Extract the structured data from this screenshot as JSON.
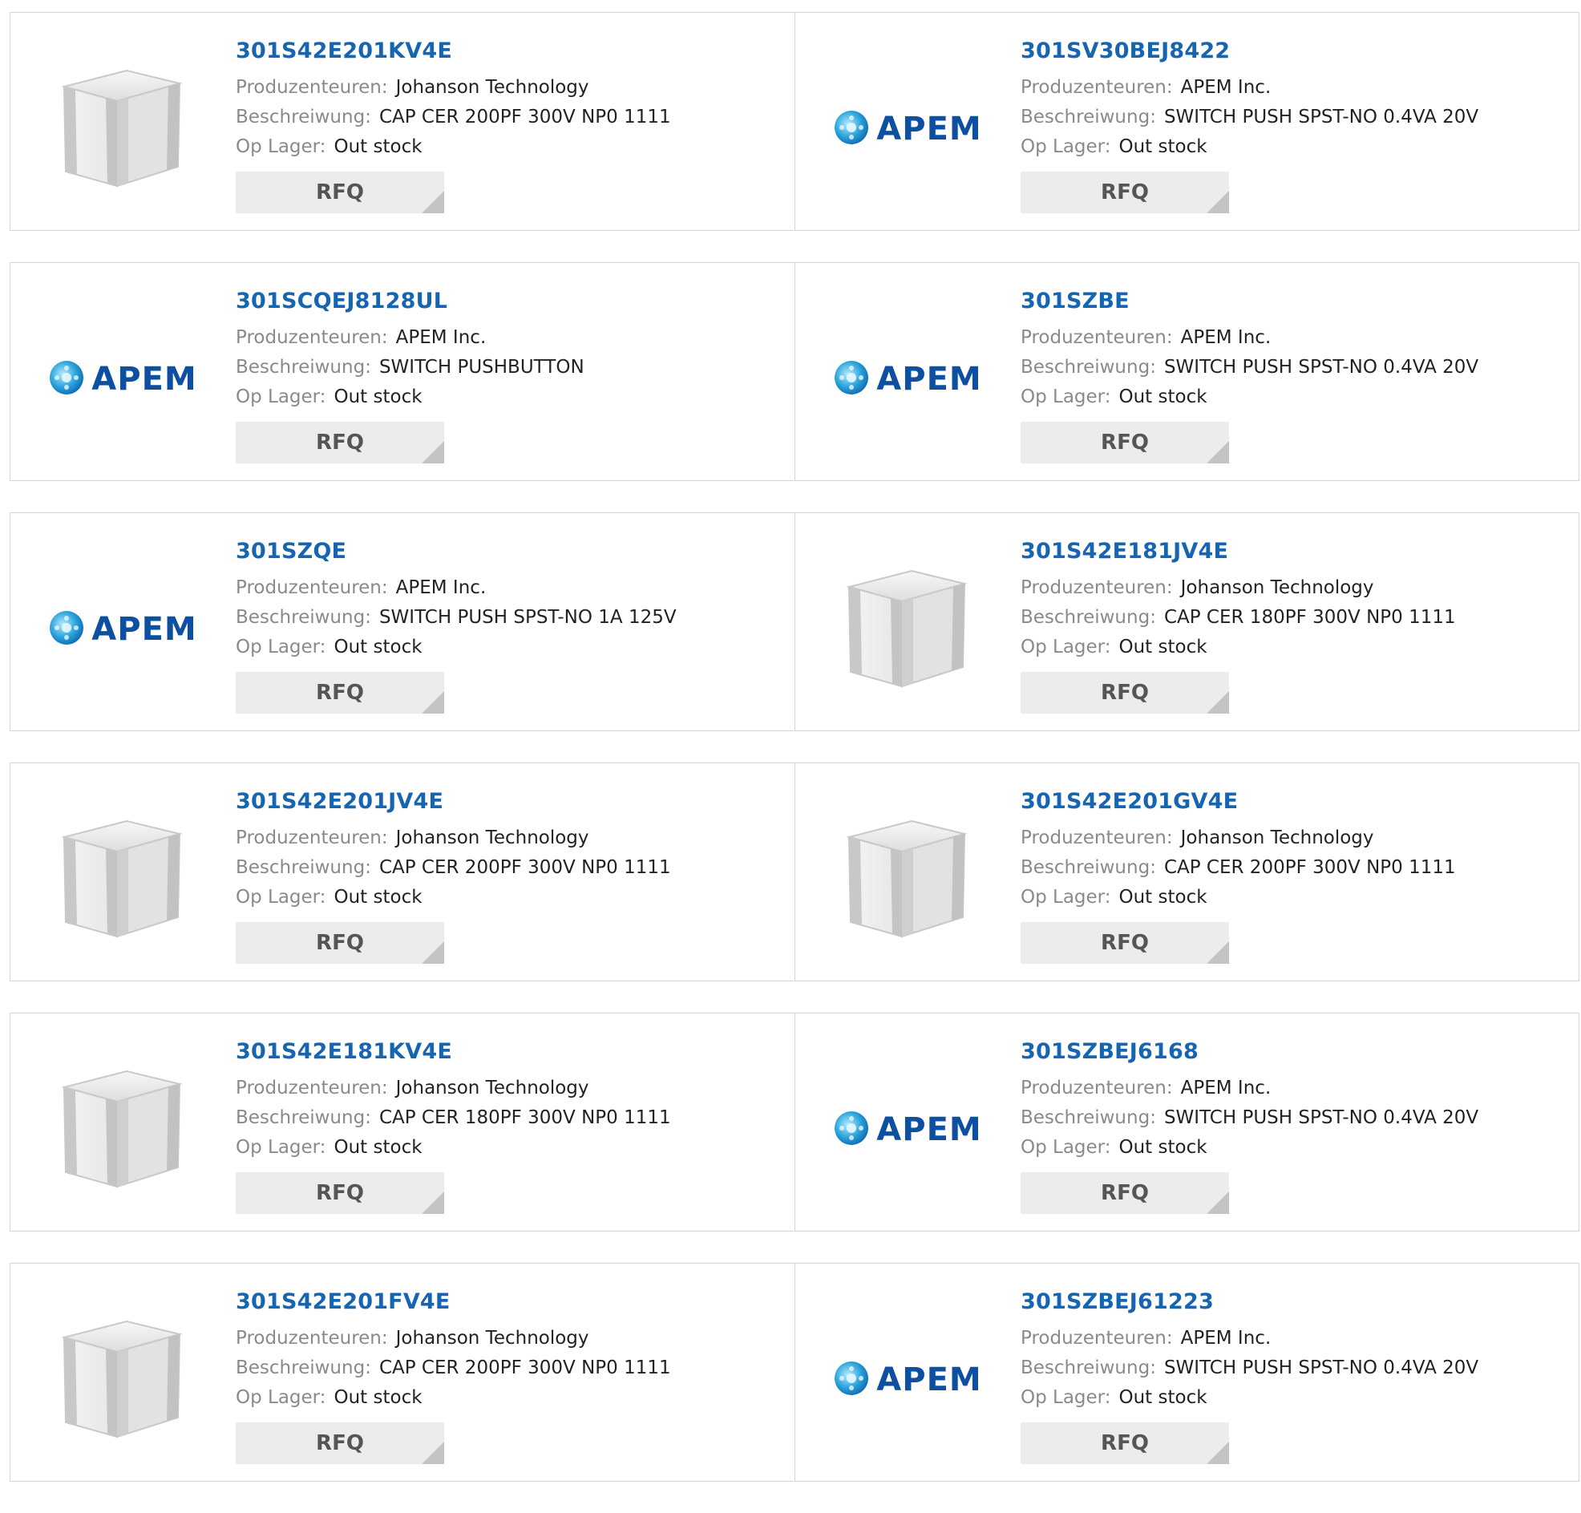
{
  "labels": {
    "manufacturer": "Produzenteuren:",
    "description": "Beschreiwung:",
    "stock": "Op Lager:",
    "rfq": "RFQ"
  },
  "colors": {
    "part_link": "#1565b2",
    "label_grey": "#8a8a8a",
    "rfq_bg": "#ececec",
    "apem_blue": "#0d4fa0"
  },
  "products": [
    {
      "part": "301S42E201KV4E",
      "manufacturer": "Johanson Technology",
      "description": "CAP CER 200PF 300V NP0 1111",
      "stock": "Out stock",
      "image": "capacitor-image"
    },
    {
      "part": "301SV30BEJ8422",
      "manufacturer": "APEM Inc.",
      "description": "SWITCH PUSH SPST-NO 0.4VA 20V",
      "stock": "Out stock",
      "image": "apem-logo",
      "logo_text": "APEM"
    },
    {
      "part": "301SCQEJ8128UL",
      "manufacturer": "APEM Inc.",
      "description": "SWITCH PUSHBUTTON",
      "stock": "Out stock",
      "image": "apem-logo",
      "logo_text": "APEM"
    },
    {
      "part": "301SZBE",
      "manufacturer": "APEM Inc.",
      "description": "SWITCH PUSH SPST-NO 0.4VA 20V",
      "stock": "Out stock",
      "image": "apem-logo",
      "logo_text": "APEM"
    },
    {
      "part": "301SZQE",
      "manufacturer": "APEM Inc.",
      "description": "SWITCH PUSH SPST-NO 1A 125V",
      "stock": "Out stock",
      "image": "apem-logo",
      "logo_text": "APEM"
    },
    {
      "part": "301S42E181JV4E",
      "manufacturer": "Johanson Technology",
      "description": "CAP CER 180PF 300V NP0 1111",
      "stock": "Out stock",
      "image": "capacitor-image"
    },
    {
      "part": "301S42E201JV4E",
      "manufacturer": "Johanson Technology",
      "description": "CAP CER 200PF 300V NP0 1111",
      "stock": "Out stock",
      "image": "capacitor-image"
    },
    {
      "part": "301S42E201GV4E",
      "manufacturer": "Johanson Technology",
      "description": "CAP CER 200PF 300V NP0 1111",
      "stock": "Out stock",
      "image": "capacitor-image"
    },
    {
      "part": "301S42E181KV4E",
      "manufacturer": "Johanson Technology",
      "description": "CAP CER 180PF 300V NP0 1111",
      "stock": "Out stock",
      "image": "capacitor-image"
    },
    {
      "part": "301SZBEJ6168",
      "manufacturer": "APEM Inc.",
      "description": "SWITCH PUSH SPST-NO 0.4VA 20V",
      "stock": "Out stock",
      "image": "apem-logo",
      "logo_text": "APEM"
    },
    {
      "part": "301S42E201FV4E",
      "manufacturer": "Johanson Technology",
      "description": "CAP CER 200PF 300V NP0 1111",
      "stock": "Out stock",
      "image": "capacitor-image"
    },
    {
      "part": "301SZBEJ61223",
      "manufacturer": "APEM Inc.",
      "description": "SWITCH PUSH SPST-NO 0.4VA 20V",
      "stock": "Out stock",
      "image": "apem-logo",
      "logo_text": "APEM"
    }
  ]
}
